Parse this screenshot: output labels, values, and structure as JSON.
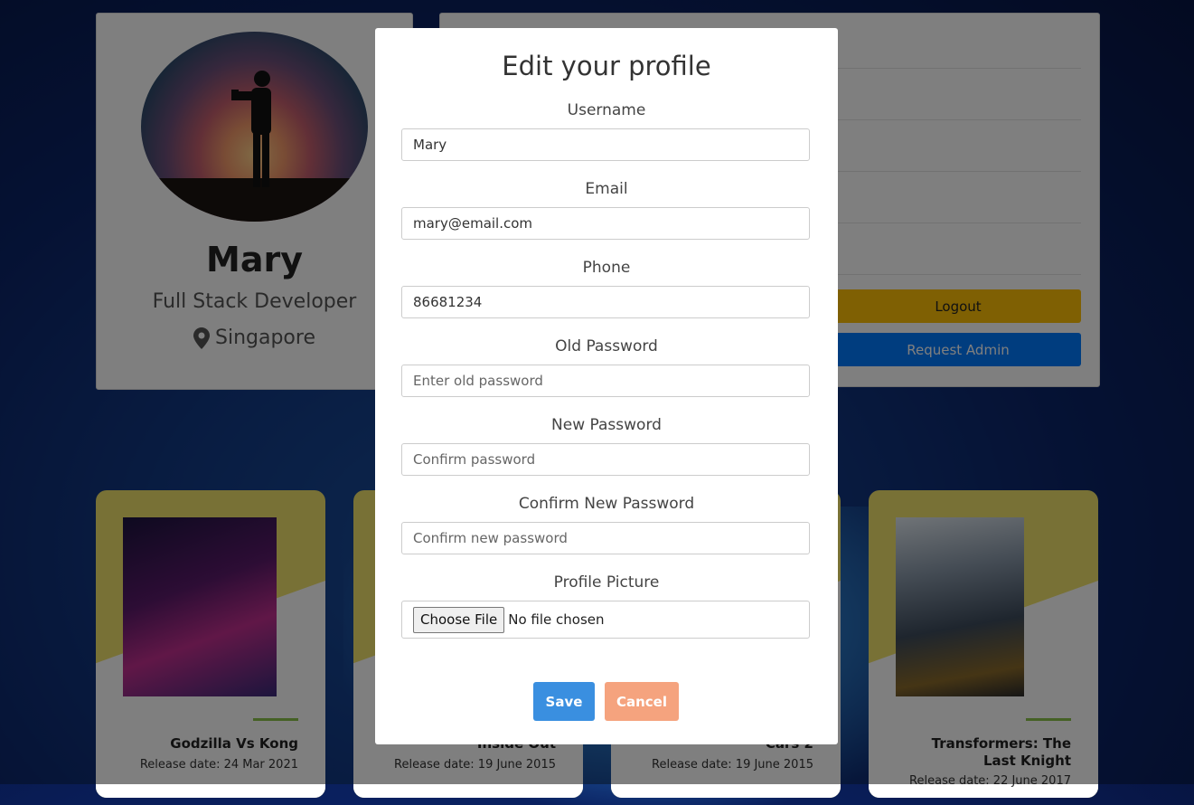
{
  "profile": {
    "name": "Mary",
    "role": "Full Stack Developer",
    "location": "Singapore"
  },
  "actions": {
    "logout_label": "Logout",
    "request_admin_label": "Request Admin"
  },
  "movies": [
    {
      "title": "Godzilla Vs Kong",
      "date": "Release date: 24 Mar 2021"
    },
    {
      "title": "Inside Out",
      "date": "Release date: 19 June 2015"
    },
    {
      "title": "Cars 2",
      "date": "Release date: 19 June 2015"
    },
    {
      "title": "Transformers: The Last Knight",
      "date": "Release date: 22 June 2017"
    }
  ],
  "modal": {
    "title": "Edit your profile",
    "fields": {
      "username": {
        "label": "Username",
        "value": "Mary"
      },
      "email": {
        "label": "Email",
        "value": "mary@email.com"
      },
      "phone": {
        "label": "Phone",
        "value": "86681234"
      },
      "old_password": {
        "label": "Old Password",
        "placeholder": "Enter old password"
      },
      "new_password": {
        "label": "New Password",
        "placeholder": "Confirm password"
      },
      "confirm_password": {
        "label": "Confirm New Password",
        "placeholder": "Confirm new password"
      },
      "picture": {
        "label": "Profile Picture",
        "button": "Choose File",
        "status": "No file chosen"
      }
    },
    "save_label": "Save",
    "cancel_label": "Cancel"
  },
  "colors": {
    "logout": "#ffc107",
    "request_admin": "#007bff",
    "save": "#3a8fe0",
    "cancel": "#f5a37e",
    "card_accent": "#f1e36d"
  }
}
